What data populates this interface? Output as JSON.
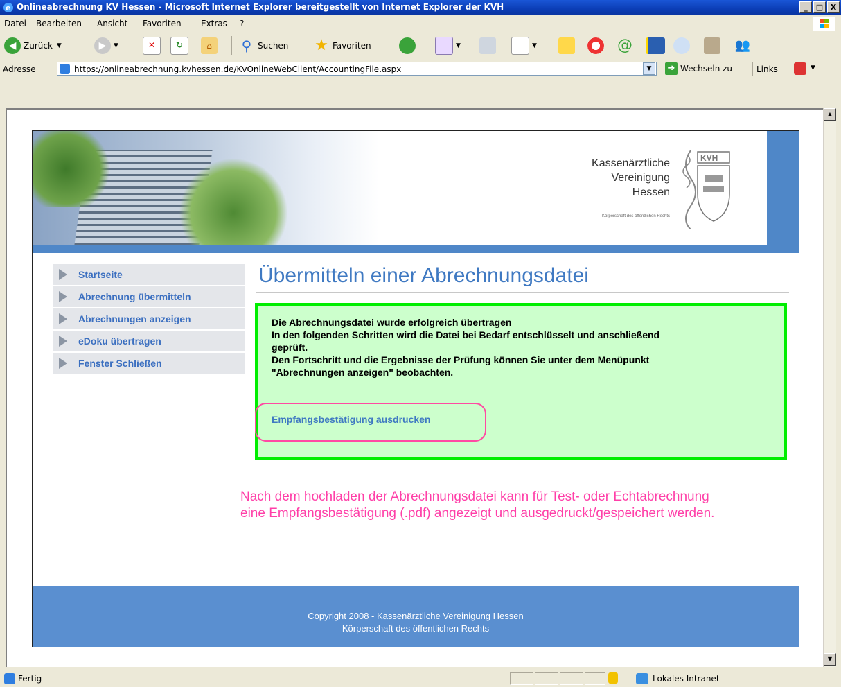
{
  "window": {
    "title": "Onlineabrechnung KV Hessen - Microsoft Internet Explorer bereitgestellt von Internet Explorer der KVH",
    "minimize": "_",
    "maximize": "□",
    "close": "X"
  },
  "menu": [
    "Datei",
    "Bearbeiten",
    "Ansicht",
    "Favoriten",
    "Extras",
    "?"
  ],
  "toolbar": {
    "back": "Zurück",
    "search": "Suchen",
    "favorites": "Favoriten"
  },
  "address": {
    "label": "Adresse",
    "url": "https://onlineabrechnung.kvhessen.de/KvOnlineWebClient/AccountingFile.aspx",
    "go": "Wechseln zu",
    "links": "Links"
  },
  "banner": {
    "org_line1": "Kassenärztliche",
    "org_line2": "Vereinigung",
    "org_line3": "Hessen",
    "org_sub": "Körperschaft des öffentlichen Rechts",
    "seal_text": "KVH"
  },
  "nav": [
    "Startseite",
    "Abrechnung übermitteln",
    "Abrechnungen anzeigen",
    "eDoku übertragen",
    "Fenster Schließen"
  ],
  "main": {
    "heading": "Übermitteln einer Abrechnungsdatei",
    "message_lines": [
      "Die Abrechnungsdatei wurde erfolgreich übertragen",
      "In den folgenden Schritten wird die Datei bei Bedarf entschlüsselt und anschließend",
      "geprüft.",
      "Den Fortschritt und die Ergebnisse der Prüfung können Sie unter dem Menüpunkt",
      "\"Abrechnungen anzeigen\" beobachten."
    ],
    "receipt_link": "Empfangsbestätigung ausdrucken",
    "note_line1": "Nach dem hochladen der Abrechnungsdatei kann für Test- oder Echtabrechnung",
    "note_line2": "eine Empfangsbestätigung (.pdf) angezeigt und ausgedruckt/gespeichert werden."
  },
  "footer": {
    "line1": "Copyright 2008 - Kassenärztliche Vereinigung Hessen",
    "line2": "Körperschaft des öffentlichen Rechts"
  },
  "status": {
    "text": "Fertig",
    "zone": "Lokales Intranet"
  },
  "colors": {
    "accent_blue": "#3f79c2",
    "success_border": "#00ee00",
    "success_bg": "#ccffcc",
    "annotation_pink": "#ff3fa8",
    "footer_blue": "#5a8fd0"
  }
}
